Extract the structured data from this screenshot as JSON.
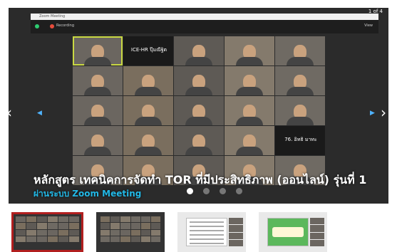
{
  "slideshow": {
    "counter": "1 of 4",
    "caption": "หลักสูตร เทคนิคการจัดทำ TOR ที่มีประสิทธิภาพ (ออนไลน์) รุ่นที่ 1",
    "subcaption": "ผ่านระบบ Zoom Meeting",
    "dots_total": 4,
    "active_dot": 0
  },
  "zoom": {
    "window_title": "Zoom Meeting",
    "recording_label": "Recording",
    "view_label": "View",
    "tiles": [
      {
        "label": "",
        "kind": "person",
        "highlight": true
      },
      {
        "label": "ICE-HR ปุ๊มณีฐิต",
        "kind": "text"
      },
      {
        "label": "",
        "kind": "person"
      },
      {
        "label": "",
        "kind": "person"
      },
      {
        "label": "",
        "kind": "person"
      },
      {
        "label": "",
        "kind": "person"
      },
      {
        "label": "",
        "kind": "person"
      },
      {
        "label": "",
        "kind": "person"
      },
      {
        "label": "",
        "kind": "person"
      },
      {
        "label": "",
        "kind": "person"
      },
      {
        "label": "",
        "kind": "person"
      },
      {
        "label": "",
        "kind": "person"
      },
      {
        "label": "",
        "kind": "person"
      },
      {
        "label": "",
        "kind": "person"
      },
      {
        "label": "",
        "kind": "person"
      },
      {
        "label": "",
        "kind": "person"
      },
      {
        "label": "",
        "kind": "person"
      },
      {
        "label": "",
        "kind": "person"
      },
      {
        "label": "",
        "kind": "person"
      },
      {
        "label": "76. อิทธิ มาทะ",
        "kind": "text"
      },
      {
        "label": "",
        "kind": "person"
      },
      {
        "label": "",
        "kind": "person"
      },
      {
        "label": "",
        "kind": "person"
      },
      {
        "label": "",
        "kind": "person"
      },
      {
        "label": "",
        "kind": "person"
      }
    ]
  },
  "thumbnails": [
    {
      "kind": "zoom",
      "selected": true
    },
    {
      "kind": "zoom",
      "selected": false
    },
    {
      "kind": "doc",
      "selected": false
    },
    {
      "kind": "green",
      "selected": false
    }
  ],
  "icons": {
    "prev": "chevron-left-icon",
    "next": "chevron-right-icon"
  },
  "colors": {
    "caption": "#ffffff",
    "subcaption": "#22b8e6",
    "selected_thumb_border": "#b21f1f",
    "stage_bg": "#2b2b2b"
  }
}
